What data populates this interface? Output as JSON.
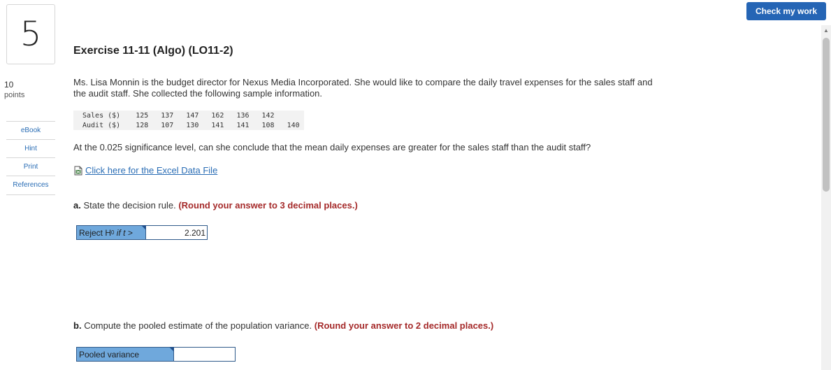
{
  "question": {
    "number": "5",
    "points_value": "10",
    "points_label": "points"
  },
  "sidebar": {
    "items": [
      {
        "label": "eBook"
      },
      {
        "label": "Hint"
      },
      {
        "label": "Print"
      },
      {
        "label": "References"
      }
    ]
  },
  "header": {
    "check_button": "Check my work"
  },
  "exercise": {
    "title": "Exercise 11-11 (Algo) (LO11-2)",
    "intro": "Ms. Lisa Monnin is the budget director for Nexus Media Incorporated. She would like to compare the daily travel expenses for the sales staff and the audit staff. She collected the following sample information.",
    "table": {
      "rows": [
        {
          "label": "Sales ($)",
          "values": [
            "125",
            "137",
            "147",
            "162",
            "136",
            "142",
            ""
          ]
        },
        {
          "label": "Audit ($)",
          "values": [
            "128",
            "107",
            "130",
            "141",
            "141",
            "108",
            "140"
          ]
        }
      ]
    },
    "question_text": "At the 0.025 significance level, can she conclude that the mean daily expenses are greater for the sales staff than the audit staff?",
    "excel_link": "Click here for the Excel Data File"
  },
  "part_a": {
    "prefix": "a.",
    "text": "State the decision rule.",
    "hint": "(Round your answer to 3 decimal places.)",
    "label_pre": "Reject H",
    "label_sub": "0",
    "label_post": " if t >",
    "value": "2.201"
  },
  "part_b": {
    "prefix": "b.",
    "text": "Compute the pooled estimate of the population variance.",
    "hint": "(Round your answer to 2 decimal places.)",
    "label": "Pooled variance",
    "value": ""
  }
}
